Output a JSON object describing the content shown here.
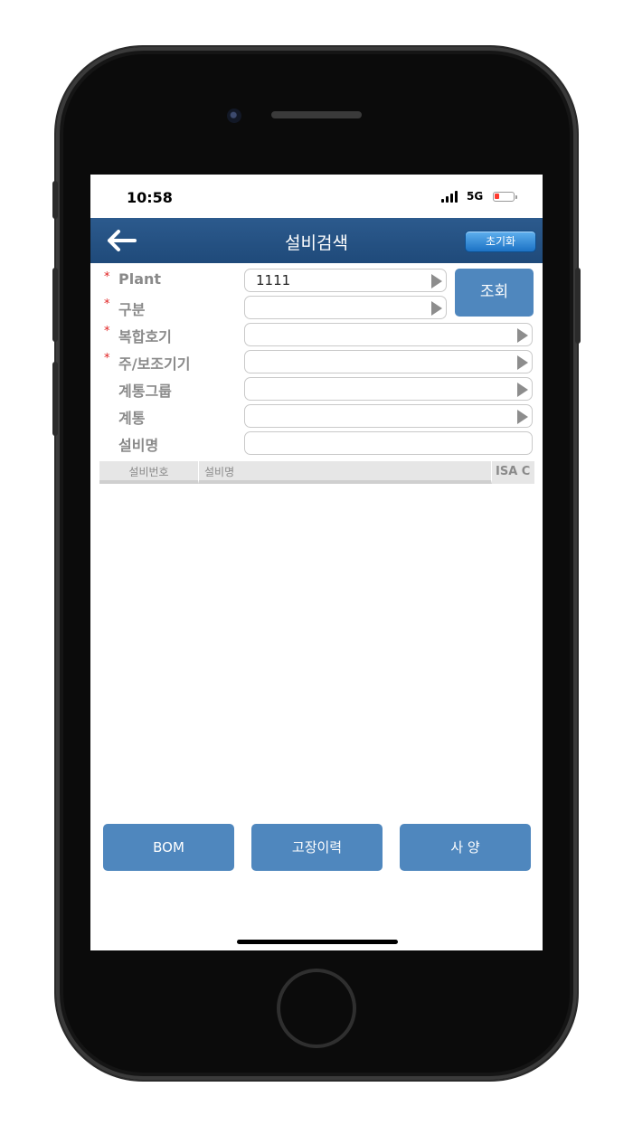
{
  "status": {
    "time": "10:58",
    "network": "5G"
  },
  "header": {
    "title": "설비검색",
    "reset_label": "초기화"
  },
  "form": {
    "fields": [
      {
        "label": "Plant",
        "required": true,
        "value": "1111"
      },
      {
        "label": "구분",
        "required": true,
        "value": ""
      },
      {
        "label": "복합호기",
        "required": true,
        "value": ""
      },
      {
        "label": "주/보조기기",
        "required": true,
        "value": ""
      },
      {
        "label": "계통그룹",
        "required": false,
        "value": ""
      },
      {
        "label": "계통",
        "required": false,
        "value": ""
      },
      {
        "label": "설비명",
        "required": false,
        "value": ""
      }
    ],
    "required_marker": "*",
    "search_label": "조회"
  },
  "table": {
    "columns": [
      "설비번호",
      "설비명",
      "ISA C"
    ]
  },
  "actions": {
    "bom_label": "BOM",
    "history_label": "고장이력",
    "spec_label": "사 양"
  },
  "colors": {
    "nav": "#1f4a7a",
    "button": "#4f87be",
    "required": "#e02020",
    "battery_low": "#ff3b30"
  }
}
